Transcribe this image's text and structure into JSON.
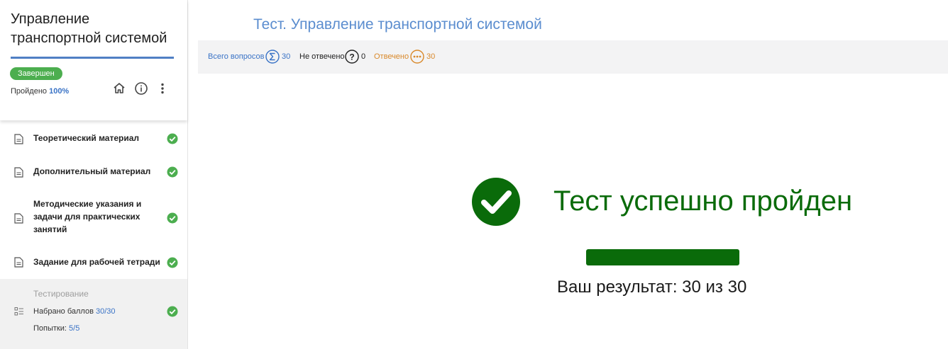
{
  "sidebar": {
    "course_title": "Управление транспортной системой",
    "status_badge": "Завершен",
    "progress_label": "Пройдено",
    "progress_value": "100%",
    "progress_fraction": 1.0,
    "header_icons": [
      "home-icon",
      "info-icon",
      "more-vert-icon"
    ],
    "items": [
      {
        "label": "Теоретический материал",
        "icon": "document-icon",
        "done": true
      },
      {
        "label": "Дополнительный материал",
        "icon": "document-icon",
        "done": true
      },
      {
        "label": "Методические указания и задачи для практических занятий",
        "icon": "document-icon",
        "done": true
      },
      {
        "label": "Задание для рабочей тетради",
        "icon": "document-icon",
        "done": true
      }
    ],
    "test": {
      "title": "Тестирование",
      "score_label": "Набрано баллов",
      "score_value": "30/30",
      "attempts_label": "Попытки:",
      "attempts_value": "5/5",
      "icon": "checklist-icon",
      "done": true
    }
  },
  "main": {
    "title": "Тест. Управление транспортной системой",
    "stats": {
      "total_label": "Всего вопросов",
      "total_value": "30",
      "unanswered_label": "Не отвечено",
      "unanswered_value": "0",
      "answered_label": "Отвечено",
      "answered_value": "30"
    },
    "result": {
      "title": "Тест успешно пройден",
      "score_text": "Ваш результат: 30 из 30",
      "score_fraction": 1.0
    }
  },
  "colors": {
    "accent_blue": "#4f7fc4",
    "success_green": "#4cae4f",
    "result_green": "#0a6b0a",
    "answered_orange": "#d9892b"
  }
}
